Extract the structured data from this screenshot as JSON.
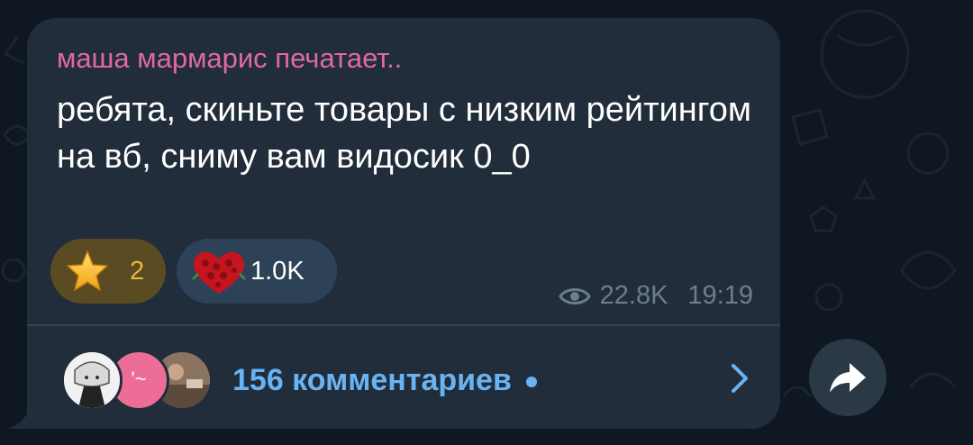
{
  "message": {
    "typing_status": "маша мармарис печатает..",
    "text": "ребята, скиньте товары с низким рейтингом на вб, сниму вам видосик 0_0",
    "reactions": [
      {
        "icon": "star-icon",
        "count": "2"
      },
      {
        "icon": "heart-roses-icon",
        "count": "1.0K"
      }
    ],
    "views": "22.8K",
    "time": "19:19"
  },
  "comments": {
    "label": "156 комментариев",
    "avatars": [
      "avatar-manga",
      "avatar-pink",
      "avatar-photo"
    ],
    "second_avatar_text": "'~"
  },
  "colors": {
    "background": "#0f1822",
    "bubble": "#212d3b",
    "sender": "#e06a9e",
    "link": "#6ab3f3",
    "meta": "#6d7d8d"
  }
}
